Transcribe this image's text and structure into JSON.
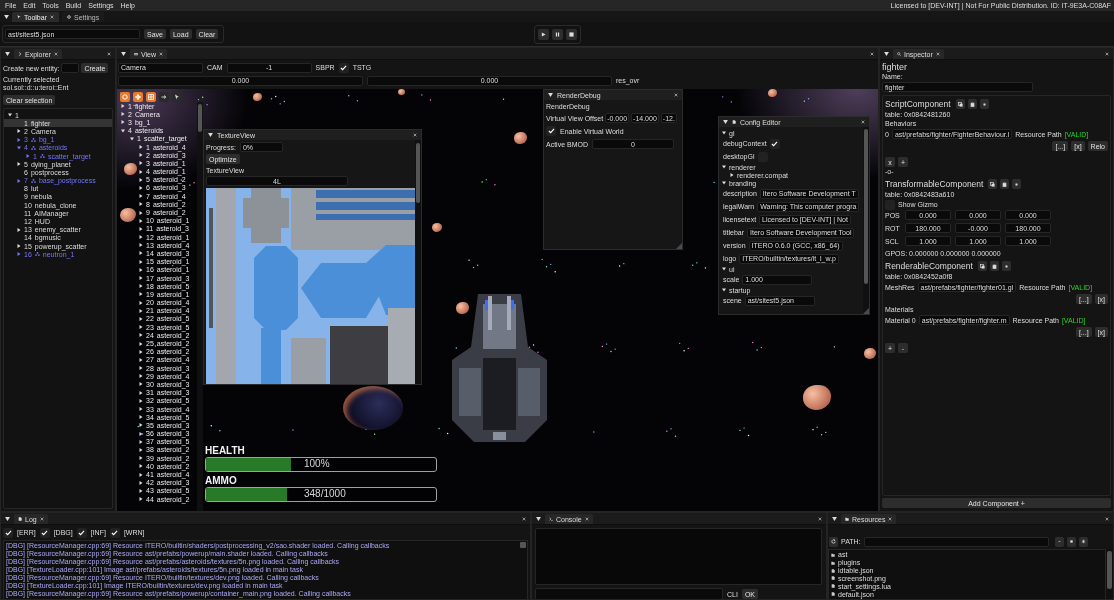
{
  "menu_bar": {
    "items": [
      "File",
      "Edit",
      "Tools",
      "Build",
      "Settings",
      "Help"
    ],
    "notice": "Licensed to [DEV-INT] | Not For Public Distribution. ID: IT-9E3A-C08AF"
  },
  "top_tabs": [
    {
      "label": "Toolbar",
      "selected": true
    },
    {
      "label": "Settings",
      "selected": false
    }
  ],
  "toolbar": {
    "scene_path": "ast/sitest5.json",
    "buttons": [
      "Save",
      "Load",
      "Clear"
    ]
  },
  "explorer": {
    "title": "Explorer",
    "create_label": "Create new entity:",
    "create_button": "Create",
    "selection_text": "Currently selected sol.sol::d::u:teroi::Ent",
    "clear_button": "Clear selection",
    "tree": [
      {
        "name": "1",
        "expanded": true,
        "selected": false,
        "prefab": false,
        "children": [
          {
            "index": "1",
            "name": "fighter",
            "selected": true,
            "prefab": false
          },
          {
            "index": "2",
            "name": "Camera",
            "expanded": false,
            "selected": false,
            "prefab": false
          },
          {
            "index": "3",
            "name": "bg_1",
            "expanded": false,
            "selected": false,
            "prefab": true
          },
          {
            "index": "4",
            "name": "asteroids",
            "expanded": true,
            "selected": false,
            "prefab": true,
            "children": [
              {
                "index": "1",
                "name": "scatter_target",
                "expanded": false,
                "selected": false,
                "prefab": true
              }
            ]
          },
          {
            "index": "5",
            "name": "dying_planet",
            "expanded": false,
            "selected": false,
            "prefab": false
          },
          {
            "index": "6",
            "name": "postprocess",
            "selected": false,
            "prefab": false
          },
          {
            "index": "7",
            "name": "base_postprocess",
            "expanded": false,
            "selected": false,
            "prefab": true
          },
          {
            "index": "8",
            "name": "lut",
            "selected": false,
            "prefab": false
          },
          {
            "index": "9",
            "name": "nebula",
            "selected": false,
            "prefab": false
          },
          {
            "index": "10",
            "name": "nebula_clone",
            "selected": false,
            "prefab": false
          },
          {
            "index": "11",
            "name": "AIManager",
            "selected": false,
            "prefab": false
          },
          {
            "index": "12",
            "name": "HUD",
            "selected": false,
            "prefab": false
          },
          {
            "index": "13",
            "name": "enemy_scatter",
            "expanded": false,
            "selected": false,
            "prefab": false
          },
          {
            "index": "14",
            "name": "bgmusic",
            "selected": false,
            "prefab": false
          },
          {
            "index": "15",
            "name": "powerup_scatter",
            "expanded": false,
            "selected": false,
            "prefab": false
          },
          {
            "index": "16",
            "name": "neutron_1",
            "expanded": false,
            "selected": false,
            "prefab": true
          }
        ]
      }
    ]
  },
  "view": {
    "title": "View",
    "controls": [
      {
        "kind": "field",
        "value": "Camera"
      },
      {
        "kind": "label",
        "text": "CAM"
      },
      {
        "kind": "field",
        "value": "-1"
      },
      {
        "kind": "label",
        "text": "SBPR"
      },
      {
        "kind": "checkbox",
        "checked": true
      },
      {
        "kind": "label",
        "text": "TSTG"
      }
    ],
    "range_controls": [
      {
        "kind": "field",
        "value": "0.000"
      },
      {
        "kind": "field",
        "value": "0.000"
      },
      {
        "kind": "label",
        "text": "res_ovr"
      }
    ],
    "tools": [
      {
        "active": true
      },
      {
        "active": true
      },
      {
        "active": true
      },
      {
        "active": false
      },
      {
        "active": false
      }
    ],
    "scene_tree": [
      {
        "index": "1",
        "name": "fighter",
        "expanded": false
      },
      {
        "index": "2",
        "name": "Camera",
        "expanded": false
      },
      {
        "index": "3",
        "name": "bg_1",
        "expanded": false
      },
      {
        "index": "4",
        "name": "asteroids",
        "expanded": true,
        "children": [
          {
            "index": "1",
            "name": "scatter_target",
            "expanded": true,
            "children": [
              {
                "index": "1",
                "name": "asteroid_4",
                "expanded": false
              },
              {
                "index": "2",
                "name": "asteroid_3",
                "expanded": false
              },
              {
                "index": "3",
                "name": "asteroid_1",
                "expanded": false
              },
              {
                "index": "4",
                "name": "asteroid_1",
                "expanded": false
              },
              {
                "index": "5",
                "name": "asteroid_2",
                "expanded": false
              },
              {
                "index": "6",
                "name": "asteroid_3",
                "expanded": false
              },
              {
                "index": "7",
                "name": "asteroid_4",
                "expanded": false
              },
              {
                "index": "8",
                "name": "asteroid_2",
                "expanded": false
              },
              {
                "index": "9",
                "name": "asteroid_2",
                "expanded": false
              },
              {
                "index": "10",
                "name": "asteroid_1",
                "expanded": false
              },
              {
                "index": "11",
                "name": "asteroid_3",
                "expanded": false
              },
              {
                "index": "12",
                "name": "asteroid_1",
                "expanded": false
              },
              {
                "index": "13",
                "name": "asteroid_4",
                "expanded": false
              },
              {
                "index": "14",
                "name": "asteroid_3",
                "expanded": false
              },
              {
                "index": "15",
                "name": "asteroid_1",
                "expanded": false
              },
              {
                "index": "16",
                "name": "asteroid_1",
                "expanded": false
              },
              {
                "index": "17",
                "name": "asteroid_3",
                "expanded": false
              },
              {
                "index": "18",
                "name": "asteroid_5",
                "expanded": false
              },
              {
                "index": "19",
                "name": "asteroid_1",
                "expanded": false
              },
              {
                "index": "20",
                "name": "asteroid_4",
                "expanded": false
              },
              {
                "index": "21",
                "name": "asteroid_4",
                "expanded": false
              },
              {
                "index": "22",
                "name": "asteroid_5",
                "expanded": false
              },
              {
                "index": "23",
                "name": "asteroid_5",
                "expanded": false
              },
              {
                "index": "24",
                "name": "asteroid_2",
                "expanded": false
              },
              {
                "index": "25",
                "name": "asteroid_2",
                "expanded": false
              },
              {
                "index": "26",
                "name": "asteroid_2",
                "expanded": false
              },
              {
                "index": "27",
                "name": "asteroid_4",
                "expanded": false
              },
              {
                "index": "28",
                "name": "asteroid_3",
                "expanded": false
              },
              {
                "index": "29",
                "name": "asteroid_4",
                "expanded": false
              },
              {
                "index": "30",
                "name": "asteroid_3",
                "expanded": false
              },
              {
                "index": "31",
                "name": "asteroid_3",
                "expanded": false
              },
              {
                "index": "32",
                "name": "asteroid_5",
                "expanded": false
              },
              {
                "index": "33",
                "name": "asteroid_4",
                "expanded": false
              },
              {
                "index": "34",
                "name": "asteroid_5",
                "expanded": false
              },
              {
                "index": "35",
                "name": "asteroid_3",
                "expanded": false
              },
              {
                "index": "36",
                "name": "asteroid_3",
                "expanded": false
              },
              {
                "index": "37",
                "name": "asteroid_5",
                "expanded": false
              },
              {
                "index": "38",
                "name": "asteroid_2",
                "expanded": false
              },
              {
                "index": "39",
                "name": "asteroid_2",
                "expanded": false
              },
              {
                "index": "40",
                "name": "asteroid_2",
                "expanded": false
              },
              {
                "index": "41",
                "name": "asteroid_4",
                "expanded": false
              },
              {
                "index": "42",
                "name": "asteroid_3",
                "expanded": false
              },
              {
                "index": "43",
                "name": "asteroid_5",
                "expanded": false
              },
              {
                "index": "44",
                "name": "asteroid_2",
                "expanded": false
              }
            ]
          }
        ]
      }
    ],
    "hud": [
      {
        "label": "HEALTH",
        "reading": "100%",
        "level": 0.37
      },
      {
        "label": "AMMO",
        "reading": "348/1000",
        "level": 0.35
      }
    ]
  },
  "texture_view": {
    "title": "TextureView",
    "progress_label": "Progress:",
    "progress_value": "0%",
    "optimize_button": "Optimize",
    "section_label": "TextureView",
    "size_value": "4L"
  },
  "render_debug": {
    "title": "RenderDebug",
    "heading": "RenderDebug",
    "offset_label": "Virtual View Offset",
    "offset_values": [
      "-0.000",
      "-14.000",
      "-12."
    ],
    "virtual_world": {
      "label": "Enable Virtual World",
      "checked": true
    },
    "bmod_label": "Active BMOD",
    "bmod_value": "0"
  },
  "config_editor": {
    "title": "Config Editor",
    "tree": [
      {
        "kind": "group",
        "label": "gl",
        "expanded": true,
        "children": [
          {
            "kind": "checkbox",
            "label": "debugContext",
            "checked": true
          },
          {
            "kind": "checkbox",
            "label": "desktopGl",
            "checked": false
          }
        ]
      },
      {
        "kind": "group",
        "label": "renderer",
        "expanded": true,
        "children": [
          {
            "kind": "group",
            "label": "renderer.compat",
            "expanded": false
          }
        ]
      },
      {
        "kind": "group",
        "label": "branding",
        "expanded": true,
        "children": [
          {
            "kind": "field",
            "label": "description",
            "value": "Itero Software Development T"
          },
          {
            "kind": "field",
            "label": "legalWarn",
            "value": "Warning: This computer progra"
          },
          {
            "kind": "field",
            "label": "licensetext",
            "value": "Licensed to [DEV-INT] | Not"
          },
          {
            "kind": "field",
            "label": "titlebar",
            "value": "Itero Software Development Tool"
          },
          {
            "kind": "field",
            "label": "version",
            "value": "ITERO 0.6.0 (GCC, x86_64)"
          },
          {
            "kind": "field",
            "label": "logo",
            "value": "ITERO/builtin/textures/it_l_w.p"
          }
        ]
      },
      {
        "kind": "group",
        "label": "ui",
        "expanded": true,
        "children": [
          {
            "kind": "field",
            "label": "scale",
            "value": "1.000"
          }
        ]
      },
      {
        "kind": "group",
        "label": "startup",
        "expanded": true,
        "children": [
          {
            "kind": "field",
            "label": "scene",
            "value": "ast/sitest5.json"
          }
        ]
      }
    ]
  },
  "inspector": {
    "title": "Inspector",
    "heading": "fighter",
    "name_label": "Name:",
    "name_value": "fighter",
    "components": [
      {
        "title": "ScriptComponent",
        "rows": [
          {
            "kind": "text",
            "text": "table: 0x0842481260"
          },
          {
            "kind": "text",
            "text": "Behaviors"
          },
          {
            "kind": "resource",
            "label": "0",
            "path": "ast/prefabs/fighter/FighterBehaviour.l",
            "type": "Resource Path",
            "status": "[VALID]",
            "buttons": [
              "[...]",
              "[x]",
              "Relo"
            ]
          },
          {
            "kind": "buttons",
            "buttons": [
              "x",
              "+"
            ]
          },
          {
            "kind": "text",
            "text": "-o-"
          }
        ]
      },
      {
        "title": "TransformableComponent",
        "rows": [
          {
            "kind": "text",
            "text": "table: 0x0842483a610"
          },
          {
            "kind": "checkbox",
            "label": "Show Gizmo",
            "checked": false
          },
          {
            "kind": "vector",
            "label": "POS",
            "values": [
              "0.000",
              "0.000",
              "0.000"
            ]
          },
          {
            "kind": "vector",
            "label": "ROT",
            "values": [
              "180.000",
              "-0.000",
              "180.000"
            ]
          },
          {
            "kind": "vector",
            "label": "SCL",
            "values": [
              "1.000",
              "1.000",
              "1.000"
            ]
          },
          {
            "kind": "text",
            "text": "GPOS: 0.000000 0.000000 0.000000"
          }
        ]
      },
      {
        "title": "RenderableComponent",
        "rows": [
          {
            "kind": "text",
            "text": "table: 0x0842452a0f8"
          },
          {
            "kind": "resource",
            "label": "MeshRes",
            "path": "ast/prefabs/fighter/fighter01.gl",
            "type": "Resource Path",
            "status": "[VALID]",
            "buttons": [
              "[...]",
              "[x]"
            ]
          },
          {
            "kind": "text",
            "text": "Materials"
          },
          {
            "kind": "resource",
            "label": "Material 0",
            "path": "ast/prefabs/fighter/fighter.m",
            "type": "Resource Path",
            "status": "[VALID]",
            "buttons": [
              "[...]",
              "[x]"
            ]
          },
          {
            "kind": "buttons",
            "buttons": [
              "+",
              "-"
            ]
          }
        ]
      }
    ],
    "add_button": "Add Component +"
  },
  "log": {
    "title": "Log",
    "filters": [
      {
        "label": "[ERR]",
        "checked": true
      },
      {
        "label": "[DBG]",
        "checked": true
      },
      {
        "label": "[INF]",
        "checked": true
      },
      {
        "label": "[WRN]",
        "checked": true
      }
    ],
    "lines": [
      "[DBG] [ResourceManager.cpp:69] Resource ITERO/builtin/shaders/postprocessing_v2/sao.shader loaded. Calling callbacks",
      "[DBG] [ResourceManager.cpp:69] Resource ast/prefabs/powerup/main.shader loaded. Calling callbacks",
      "[DBG] [ResourceManager.cpp:69] Resource ast/prefabs/asteroids/textures/5n.png loaded. Calling callbacks",
      "[DBG] [TextureLoader.cpp:101] Image ast/prefabs/asteroids/textures/5n.png loaded in main task",
      "[DBG] [ResourceManager.cpp:69] Resource ITERO/builtin/textures/dev.png loaded. Calling callbacks",
      "[DBG] [TextureLoader.cpp:101] Image ITERO/builtin/textures/dev.png loaded in main task",
      "[DBG] [ResourceManager.cpp:69] Resource ast/prefabs/powerup/container_main.png loaded. Calling callbacks"
    ]
  },
  "console": {
    "title": "Console",
    "cli_label": "CLI",
    "submit_button": "OK"
  },
  "resources": {
    "title": "Resources",
    "path_label": "PATH:",
    "entries": [
      {
        "kind": "folder",
        "name": "ast"
      },
      {
        "kind": "folder",
        "name": "plugins"
      },
      {
        "kind": "file",
        "name": "idtable.json"
      },
      {
        "kind": "file",
        "name": "screenshot.png"
      },
      {
        "kind": "file",
        "name": "start_settings.lua"
      },
      {
        "kind": "file",
        "name": "default.json"
      }
    ]
  }
}
